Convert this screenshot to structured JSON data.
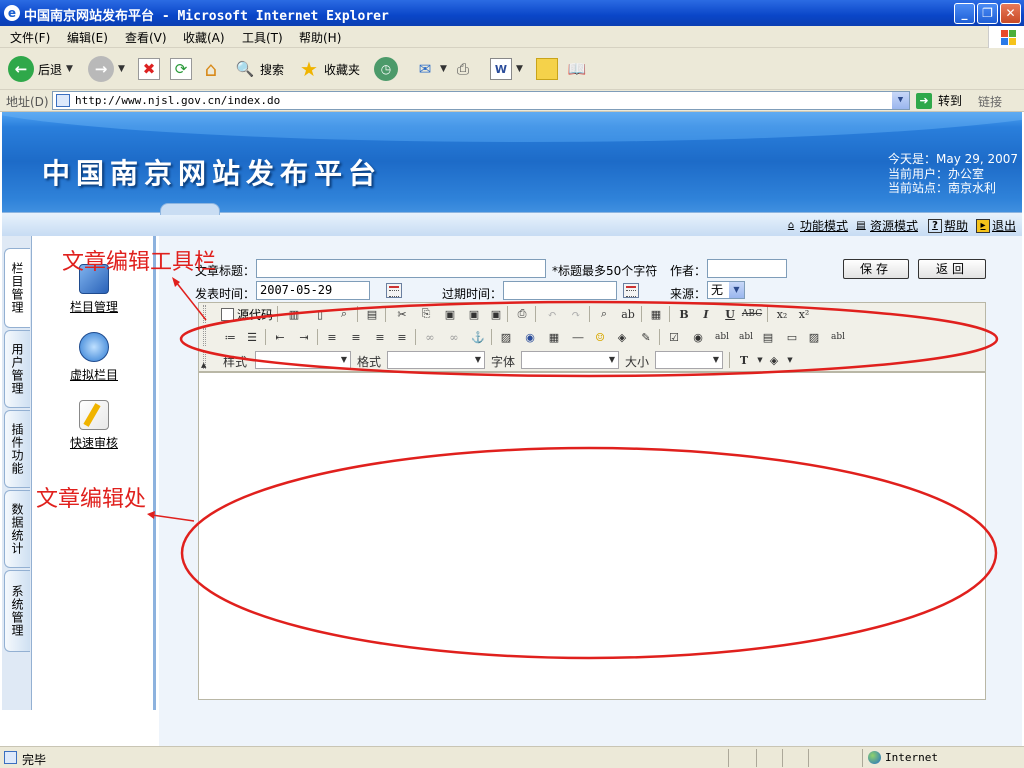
{
  "window": {
    "title": "中国南京网站发布平台 - Microsoft Internet Explorer"
  },
  "menu": {
    "items": [
      "文件(F)",
      "编辑(E)",
      "查看(V)",
      "收藏(A)",
      "工具(T)",
      "帮助(H)"
    ]
  },
  "toolbar": {
    "back_label": "后退",
    "search_label": "搜索",
    "favorites_label": "收藏夹"
  },
  "addressbar": {
    "label": "地址(D)",
    "url": "http://www.njsl.gov.cn/index.do",
    "go_label": "转到",
    "links_label": "链接"
  },
  "banner": {
    "site_title": "中国南京网站发布平台",
    "date_line": "今天是：May 29, 2007",
    "user_line": "当前用户：办公室",
    "site_line": "当前站点：南京水利",
    "nav": [
      "功能模式",
      "资源模式",
      "帮助",
      "退出"
    ]
  },
  "left_tabs": [
    "栏目管理",
    "用户管理",
    "插件功能",
    "数据统计",
    "系统管理"
  ],
  "left_panel": {
    "items": [
      "栏目管理",
      "虚拟栏目",
      "快速审核"
    ]
  },
  "form": {
    "title_label": "文章标题：",
    "title_value": "",
    "title_hint": "*标题最多50个字符",
    "author_label": "作者：",
    "author_value": "",
    "publish_label": "发表时间：",
    "publish_value": "2007-05-29",
    "expire_label": "过期时间：",
    "expire_value": "",
    "source_label": "来源：",
    "source_value": "无",
    "save_label": "保存",
    "back_label": "返回"
  },
  "editor": {
    "source_code_label": "源代码",
    "combos": [
      {
        "label": "样式",
        "value": ""
      },
      {
        "label": "格式",
        "value": ""
      },
      {
        "label": "字体",
        "value": ""
      },
      {
        "label": "大小",
        "value": ""
      }
    ]
  },
  "annotations": {
    "toolbar_note": "文章编辑工具栏",
    "editor_note": "文章编辑处",
    "color": "#e0201d"
  },
  "statusbar": {
    "text": "完毕",
    "zone": "Internet"
  },
  "colors": {
    "banner_blue": "#1d6bc8",
    "titlebar_blue": "#0a46c8"
  }
}
